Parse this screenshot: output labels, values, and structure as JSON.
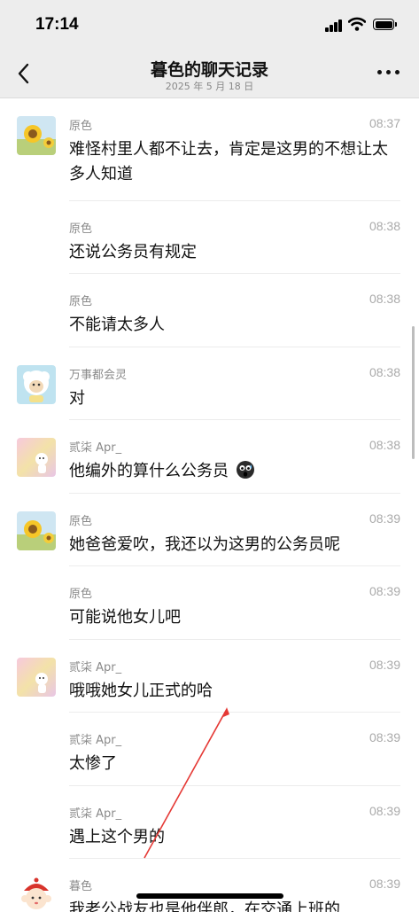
{
  "status_bar": {
    "time": "17:14",
    "icons": [
      "cellular-signal-icon",
      "wifi-icon",
      "battery-icon"
    ]
  },
  "nav": {
    "title": "暮色的聊天记录",
    "subtitle": "2025 年 5 月 18 日",
    "back_icon": "chevron-left-icon",
    "more_icon": "more-dots-icon"
  },
  "messages": [
    {
      "sender": "原色",
      "time": "08:37",
      "text": "难怪村里人都不让去，肯定是这男的不想让太多人知道",
      "avatar": "sunflower"
    },
    {
      "sender": "原色",
      "time": "08:38",
      "text": "还说公务员有规定",
      "avatar": ""
    },
    {
      "sender": "原色",
      "time": "08:38",
      "text": "不能请太多人",
      "avatar": ""
    },
    {
      "sender": "万事都会灵",
      "time": "08:38",
      "text": "对",
      "avatar": "sheep"
    },
    {
      "sender": "贰柒 Apr_",
      "time": "08:38",
      "text": "他编外的算什么公务员",
      "avatar": "pink-girl",
      "emoji": "shocked-emoji"
    },
    {
      "sender": "原色",
      "time": "08:39",
      "text": "她爸爸爱吹，我还以为这男的公务员呢",
      "avatar": "sunflower"
    },
    {
      "sender": "原色",
      "time": "08:39",
      "text": "可能说他女儿吧",
      "avatar": ""
    },
    {
      "sender": "贰柒 Apr_",
      "time": "08:39",
      "text": "哦哦她女儿正式的哈",
      "avatar": "pink-girl"
    },
    {
      "sender": "贰柒 Apr_",
      "time": "08:39",
      "text": "太惨了",
      "avatar": ""
    },
    {
      "sender": "贰柒 Apr_",
      "time": "08:39",
      "text": "遇上这个男的",
      "avatar": ""
    },
    {
      "sender": "暮色",
      "time": "08:39",
      "text": "我老公战友也是他伴郎，在交通上班的",
      "avatar": "monkey-girl"
    }
  ],
  "colors": {
    "header_bg": "#ededed",
    "annotation_arrow": "#e53935"
  }
}
